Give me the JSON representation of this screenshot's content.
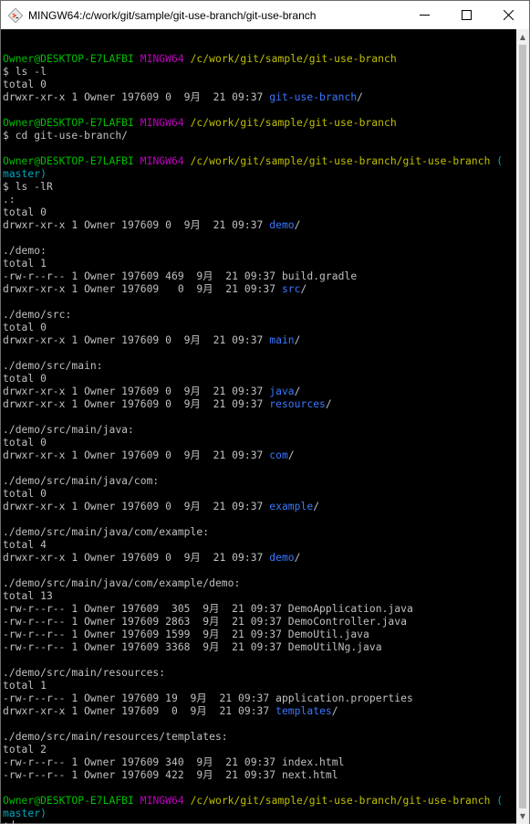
{
  "window": {
    "title": "MINGW64:/c/work/git/sample/git-use-branch/git-use-branch",
    "controls": {
      "minimize_icon": "minimize-icon",
      "maximize_icon": "maximize-icon",
      "close_icon": "close-icon"
    }
  },
  "colors": {
    "background": "#000000",
    "text": "#c0c0c0",
    "prompt_user": "#00c000",
    "prompt_system": "#c000c0",
    "prompt_path": "#c0c000",
    "git_branch": "#00a8c0",
    "directory": "#3b78ff"
  },
  "terminal": {
    "lines": [
      [],
      [
        {
          "t": "Owner@DESKTOP-E7LAFBI",
          "c": "g"
        },
        {
          "t": " "
        },
        {
          "t": "MINGW64",
          "c": "m"
        },
        {
          "t": " "
        },
        {
          "t": "/c/work/git/sample/git-use-branch",
          "c": "y"
        }
      ],
      [
        {
          "t": "$ ls -l"
        }
      ],
      [
        {
          "t": "total 0"
        }
      ],
      [
        {
          "t": "drwxr-xr-x 1 Owner 197609 0  9月  21 09:37 "
        },
        {
          "t": "git-use-branch",
          "c": "b"
        },
        {
          "t": "/"
        }
      ],
      [],
      [
        {
          "t": "Owner@DESKTOP-E7LAFBI",
          "c": "g"
        },
        {
          "t": " "
        },
        {
          "t": "MINGW64",
          "c": "m"
        },
        {
          "t": " "
        },
        {
          "t": "/c/work/git/sample/git-use-branch",
          "c": "y"
        }
      ],
      [
        {
          "t": "$ cd git-use-branch/"
        }
      ],
      [],
      [
        {
          "t": "Owner@DESKTOP-E7LAFBI",
          "c": "g"
        },
        {
          "t": " "
        },
        {
          "t": "MINGW64",
          "c": "m"
        },
        {
          "t": " "
        },
        {
          "t": "/c/work/git/sample/git-use-branch/git-use-branch",
          "c": "y"
        },
        {
          "t": " (",
          "c": "c"
        }
      ],
      [
        {
          "t": "master)",
          "c": "c"
        }
      ],
      [
        {
          "t": "$ ls -lR"
        }
      ],
      [
        {
          "t": ".:"
        }
      ],
      [
        {
          "t": "total 0"
        }
      ],
      [
        {
          "t": "drwxr-xr-x 1 Owner 197609 0  9月  21 09:37 "
        },
        {
          "t": "demo",
          "c": "b"
        },
        {
          "t": "/"
        }
      ],
      [],
      [
        {
          "t": "./demo:"
        }
      ],
      [
        {
          "t": "total 1"
        }
      ],
      [
        {
          "t": "-rw-r--r-- 1 Owner 197609 469  9月  21 09:37 build.gradle"
        }
      ],
      [
        {
          "t": "drwxr-xr-x 1 Owner 197609   0  9月  21 09:37 "
        },
        {
          "t": "src",
          "c": "b"
        },
        {
          "t": "/"
        }
      ],
      [],
      [
        {
          "t": "./demo/src:"
        }
      ],
      [
        {
          "t": "total 0"
        }
      ],
      [
        {
          "t": "drwxr-xr-x 1 Owner 197609 0  9月  21 09:37 "
        },
        {
          "t": "main",
          "c": "b"
        },
        {
          "t": "/"
        }
      ],
      [],
      [
        {
          "t": "./demo/src/main:"
        }
      ],
      [
        {
          "t": "total 0"
        }
      ],
      [
        {
          "t": "drwxr-xr-x 1 Owner 197609 0  9月  21 09:37 "
        },
        {
          "t": "java",
          "c": "b"
        },
        {
          "t": "/"
        }
      ],
      [
        {
          "t": "drwxr-xr-x 1 Owner 197609 0  9月  21 09:37 "
        },
        {
          "t": "resources",
          "c": "b"
        },
        {
          "t": "/"
        }
      ],
      [],
      [
        {
          "t": "./demo/src/main/java:"
        }
      ],
      [
        {
          "t": "total 0"
        }
      ],
      [
        {
          "t": "drwxr-xr-x 1 Owner 197609 0  9月  21 09:37 "
        },
        {
          "t": "com",
          "c": "b"
        },
        {
          "t": "/"
        }
      ],
      [],
      [
        {
          "t": "./demo/src/main/java/com:"
        }
      ],
      [
        {
          "t": "total 0"
        }
      ],
      [
        {
          "t": "drwxr-xr-x 1 Owner 197609 0  9月  21 09:37 "
        },
        {
          "t": "example",
          "c": "b"
        },
        {
          "t": "/"
        }
      ],
      [],
      [
        {
          "t": "./demo/src/main/java/com/example:"
        }
      ],
      [
        {
          "t": "total 4"
        }
      ],
      [
        {
          "t": "drwxr-xr-x 1 Owner 197609 0  9月  21 09:37 "
        },
        {
          "t": "demo",
          "c": "b"
        },
        {
          "t": "/"
        }
      ],
      [],
      [
        {
          "t": "./demo/src/main/java/com/example/demo:"
        }
      ],
      [
        {
          "t": "total 13"
        }
      ],
      [
        {
          "t": "-rw-r--r-- 1 Owner 197609  305  9月  21 09:37 DemoApplication.java"
        }
      ],
      [
        {
          "t": "-rw-r--r-- 1 Owner 197609 2863  9月  21 09:37 DemoController.java"
        }
      ],
      [
        {
          "t": "-rw-r--r-- 1 Owner 197609 1599  9月  21 09:37 DemoUtil.java"
        }
      ],
      [
        {
          "t": "-rw-r--r-- 1 Owner 197609 3368  9月  21 09:37 DemoUtilNg.java"
        }
      ],
      [],
      [
        {
          "t": "./demo/src/main/resources:"
        }
      ],
      [
        {
          "t": "total 1"
        }
      ],
      [
        {
          "t": "-rw-r--r-- 1 Owner 197609 19  9月  21 09:37 application.properties"
        }
      ],
      [
        {
          "t": "drwxr-xr-x 1 Owner 197609  0  9月  21 09:37 "
        },
        {
          "t": "templates",
          "c": "b"
        },
        {
          "t": "/"
        }
      ],
      [],
      [
        {
          "t": "./demo/src/main/resources/templates:"
        }
      ],
      [
        {
          "t": "total 2"
        }
      ],
      [
        {
          "t": "-rw-r--r-- 1 Owner 197609 340  9月  21 09:37 index.html"
        }
      ],
      [
        {
          "t": "-rw-r--r-- 1 Owner 197609 422  9月  21 09:37 next.html"
        }
      ],
      [],
      [
        {
          "t": "Owner@DESKTOP-E7LAFBI",
          "c": "g"
        },
        {
          "t": " "
        },
        {
          "t": "MINGW64",
          "c": "m"
        },
        {
          "t": " "
        },
        {
          "t": "/c/work/git/sample/git-use-branch/git-use-branch",
          "c": "y"
        },
        {
          "t": " (",
          "c": "c"
        }
      ],
      [
        {
          "t": "master)",
          "c": "c"
        }
      ],
      [
        {
          "t": "$"
        }
      ]
    ]
  }
}
